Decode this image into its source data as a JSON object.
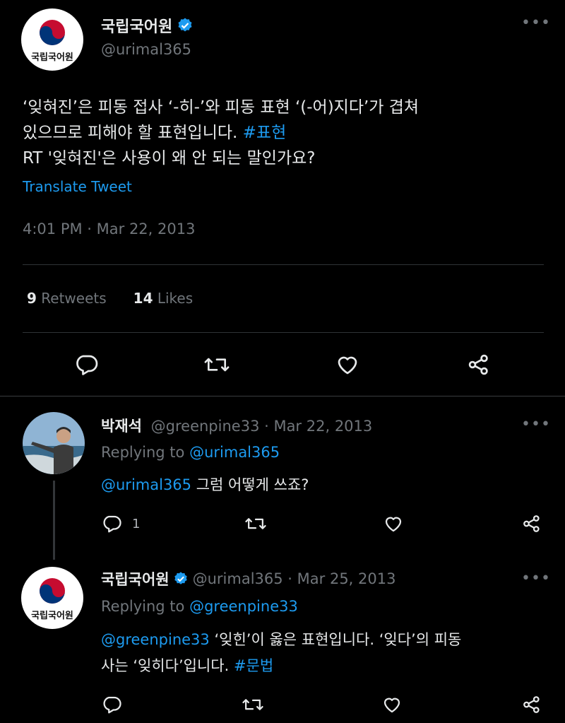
{
  "main_tweet": {
    "display_name": "국립국어원",
    "handle": "@urimal365",
    "avatar_caption": "국립국어원",
    "text_line1": "‘잊혀진’은 피동 접사 ‘-히-’와 피동 표현 ‘(-어)지다’가 겹쳐",
    "text_line2_prefix": "있으므로 피해야 할 표현입니다. ",
    "hashtag": "#표현",
    "text_line3": "RT '잊혀진'은 사용이 왜 안 되는 말인가요?",
    "translate": "Translate Tweet",
    "timestamp": "4:01 PM · Mar 22, 2013",
    "retweets_count": "9",
    "retweets_label": "Retweets",
    "likes_count": "14",
    "likes_label": "Likes"
  },
  "replies": [
    {
      "display_name": "박재석",
      "handle_date": "@greenpine33 · Mar 22, 2013",
      "replying_label": "Replying to ",
      "replying_to": "@urimal365",
      "mention": "@urimal365",
      "text": " 그럼 어떻게 쓰죠?",
      "reply_count": "1"
    },
    {
      "display_name": "국립국어원",
      "handle_date": "@urimal365 · Mar 25, 2013",
      "avatar_caption": "국립국어원",
      "replying_label": "Replying to ",
      "replying_to": "@greenpine33",
      "mention": "@greenpine33",
      "text_line1": " ‘잊힌’이 옳은 표현입니다. ‘잊다’의 피동",
      "text_line2_prefix": "사는 ‘잊히다’입니다. ",
      "hashtag": "#문법"
    }
  ],
  "icons": [
    "reply-icon",
    "retweet-icon",
    "like-icon",
    "share-icon",
    "verified-badge-icon",
    "more-icon"
  ],
  "colors": {
    "background": "#000000",
    "text": "#e7e9ea",
    "muted": "#71767b",
    "link": "#1d9bf0",
    "verified": "#1d9bf0"
  }
}
